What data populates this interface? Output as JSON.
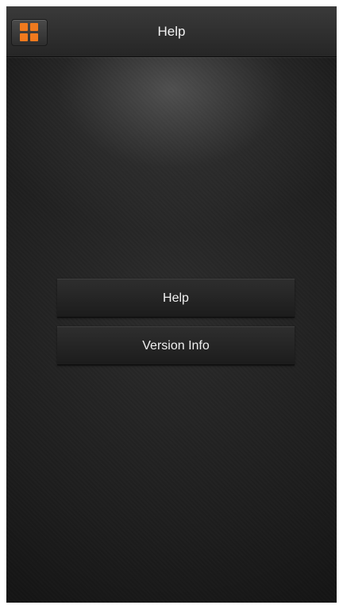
{
  "header": {
    "title": "Help",
    "menu_icon": "grid-icon"
  },
  "colors": {
    "accent": "#f07a1e"
  },
  "main": {
    "buttons": [
      {
        "label": "Help"
      },
      {
        "label": "Version Info"
      }
    ]
  }
}
